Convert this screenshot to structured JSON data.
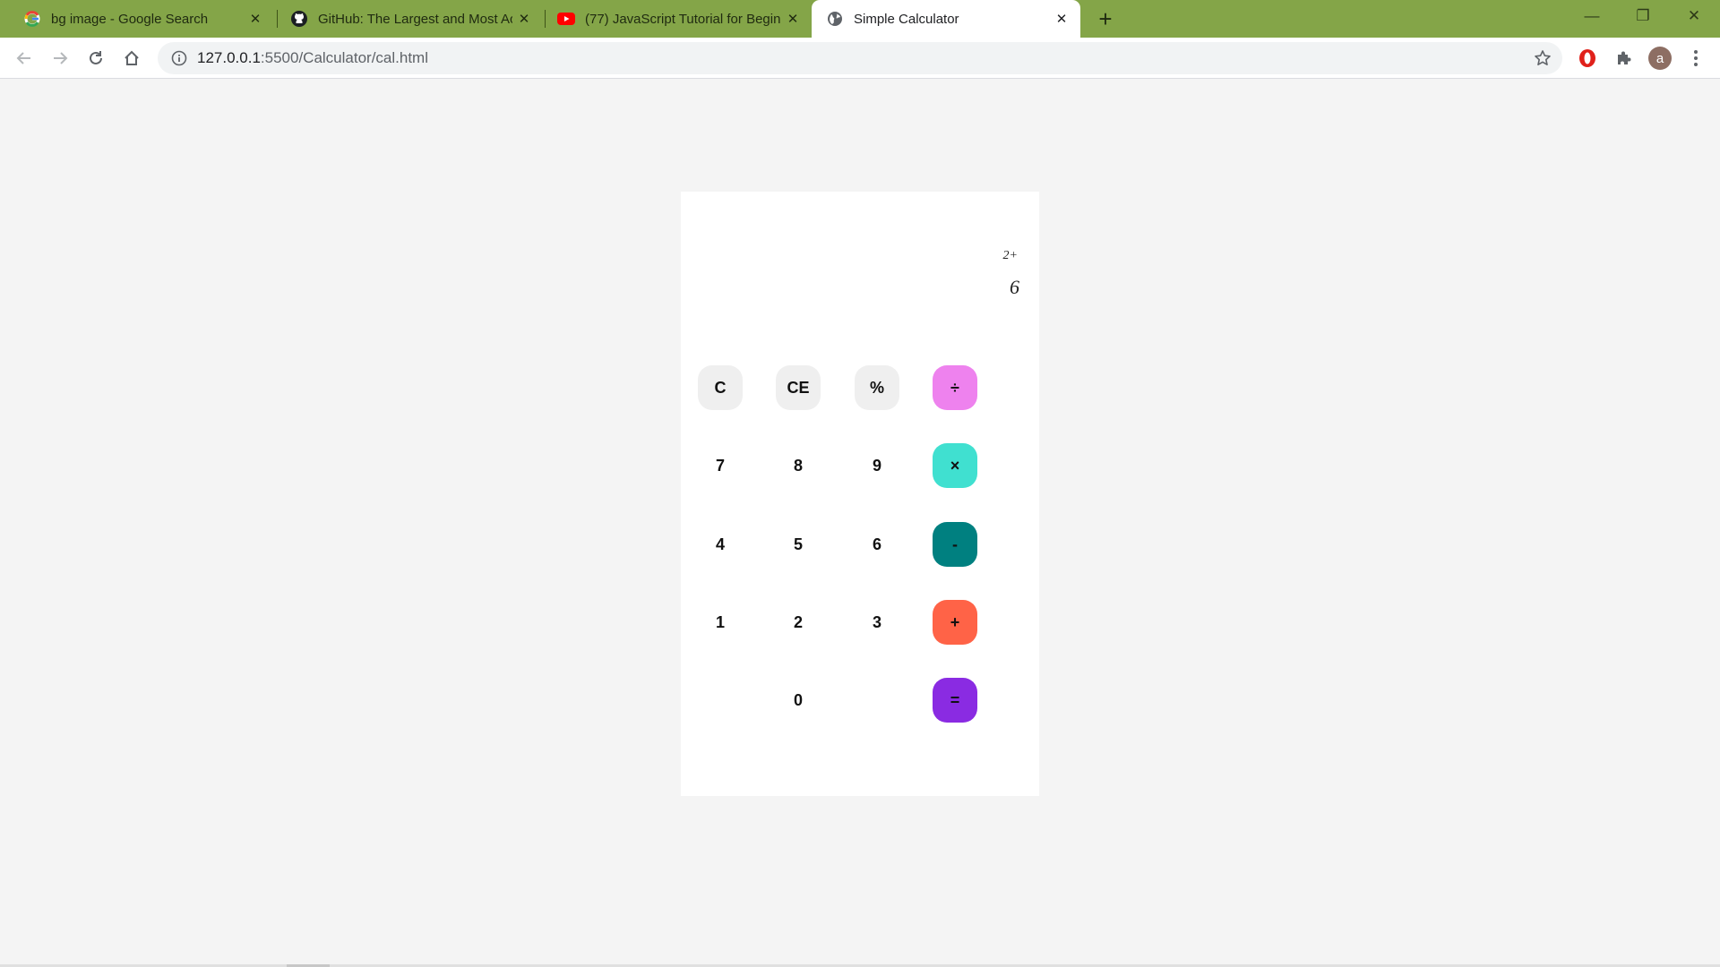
{
  "browser": {
    "tabs": [
      {
        "title": "bg image - Google Search",
        "icon": "google-icon"
      },
      {
        "title": "GitHub: The Largest and Most Ac",
        "icon": "github-icon"
      },
      {
        "title": "(77) JavaScript Tutorial for Begin",
        "icon": "youtube-icon"
      },
      {
        "title": "Simple Calculator",
        "icon": "globe-icon"
      }
    ],
    "new_tab_label": "+",
    "close_glyph": "✕",
    "window_controls": {
      "minimize": "—",
      "maximize": "❐",
      "close": "✕"
    },
    "address": {
      "host": "127.0.0.1",
      "path": ":5500/Calculator/cal.html"
    },
    "profile_initial": "a",
    "colors": {
      "frame": "#84a548",
      "toolbar": "#ffffff",
      "omnibox": "#f1f3f4",
      "page": "#f4f4f4"
    }
  },
  "calculator": {
    "previous_operand": "2+",
    "current_operand": "6",
    "buttons": {
      "clear": "C",
      "clear_entry": "CE",
      "percent": "%",
      "divide": "÷",
      "seven": "7",
      "eight": "8",
      "nine": "9",
      "multiply": "×",
      "four": "4",
      "five": "5",
      "six": "6",
      "subtract": "-",
      "one": "1",
      "two": "2",
      "three": "3",
      "add": "+",
      "zero": "0",
      "equals": "="
    },
    "colors": {
      "utility": "#efefef",
      "divide": "#ee82ee",
      "multiply": "#40e0d0",
      "subtract": "#008080",
      "add": "#ff6347",
      "equals": "#8a2be2"
    }
  }
}
